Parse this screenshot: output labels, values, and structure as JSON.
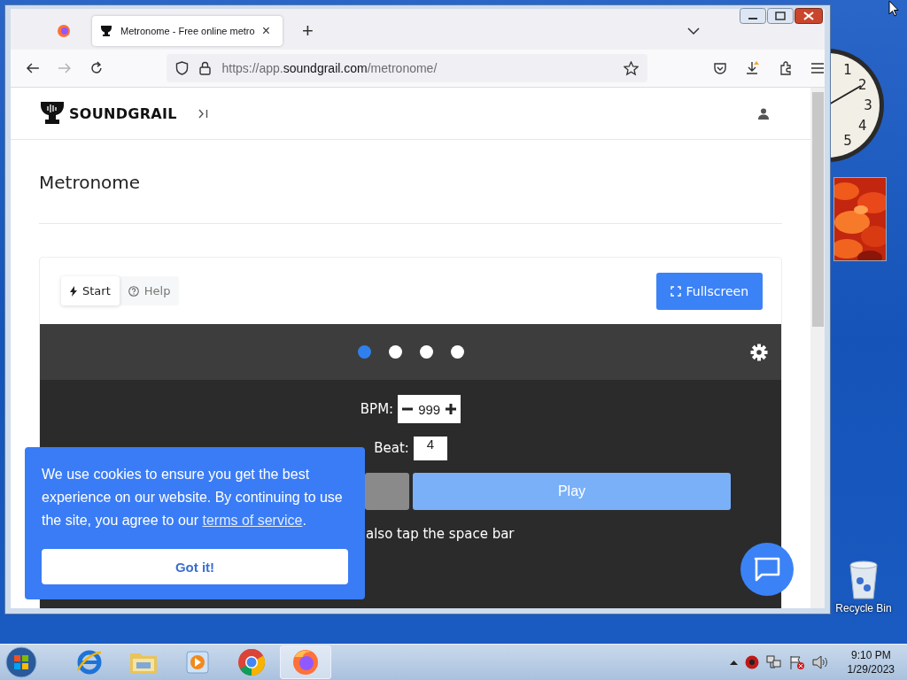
{
  "browser": {
    "tabs": [
      {
        "kind": "icon",
        "selected": false
      },
      {
        "kind": "page",
        "title": "Metronome - Free online metro",
        "close": "×",
        "selected": true
      }
    ],
    "new_tab": "+",
    "forward_disabled": true,
    "url_parts": [
      "https://app.",
      "soundgrail.com",
      "/metronome/"
    ]
  },
  "page": {
    "brand": "SOUNDGRAIL",
    "title": "Metronome"
  },
  "toolbar": {
    "tabs": [
      {
        "kind": "bolt",
        "label": "Start",
        "selected": true
      },
      {
        "kind": "help",
        "label": "Help",
        "selected": false
      }
    ],
    "fullscreen": "Fullscreen"
  },
  "metronome": {
    "beats": [
      {
        "active": true
      },
      {
        "active": false
      },
      {
        "active": false
      },
      {
        "active": false
      }
    ],
    "bpm_label": "BPM:",
    "bpm_value": "999",
    "beat_label": "Beat:",
    "beat_value": "4",
    "play": "Play",
    "hint": "also tap the space bar"
  },
  "cookie": {
    "text": "We use cookies to ensure you get the best experience on our website. By continuing to use the site, you agree to our",
    "link": "terms of service",
    "after": ".",
    "button": "Got it!"
  },
  "desktop": {
    "clock_numerals": [
      "1",
      "2",
      "3",
      "4",
      "5"
    ],
    "recycle_bin": "Recycle Bin"
  },
  "taskbar": {
    "apps": [
      {
        "kind": "ie",
        "selected": false
      },
      {
        "kind": "explorer",
        "selected": false
      },
      {
        "kind": "media",
        "selected": false
      },
      {
        "kind": "chrome",
        "selected": false
      },
      {
        "kind": "firefox",
        "selected": true
      }
    ],
    "time": "9:10 PM",
    "date": "1/29/2023"
  }
}
